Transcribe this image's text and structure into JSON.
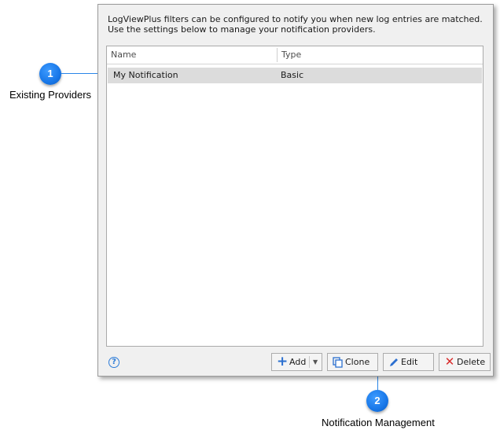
{
  "callouts": [
    {
      "number": "1",
      "label": "Existing Providers"
    },
    {
      "number": "2",
      "label": "Notification Management"
    }
  ],
  "dialog": {
    "description": "LogViewPlus filters can be configured to notify you when new log entries are matched.  Use the settings below to manage your notification providers.",
    "table": {
      "columns": [
        "Name",
        "Type"
      ],
      "rows": [
        {
          "name": "My Notification",
          "type": "Basic",
          "selected": true
        }
      ]
    },
    "help_icon": "question-circle-icon",
    "buttons": {
      "add": {
        "label": "Add",
        "icon": "plus-icon"
      },
      "clone": {
        "label": "Clone",
        "icon": "clone-icon"
      },
      "edit": {
        "label": "Edit",
        "icon": "pencil-icon"
      },
      "delete": {
        "label": "Delete",
        "icon": "x-icon"
      }
    }
  },
  "colors": {
    "callout": "#1877e8",
    "selected_row": "#dcdcdc",
    "delete_icon": "#d92b2b",
    "add_icon": "#2b6fd0"
  }
}
